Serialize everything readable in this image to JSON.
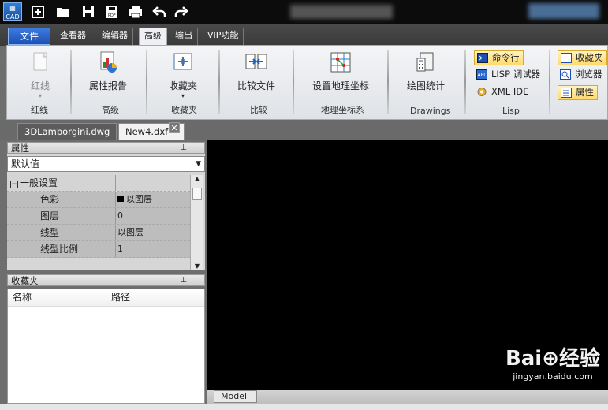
{
  "titlebar": {
    "logo_text": "CAD",
    "quick_actions": [
      "new-icon",
      "open-icon",
      "save-icon",
      "save-pdf-icon",
      "print-icon",
      "undo-icon",
      "redo-icon"
    ]
  },
  "tabs": {
    "file": "文件",
    "items": [
      "查看器",
      "编辑器",
      "高级",
      "输出",
      "VIP功能"
    ],
    "active": "高级"
  },
  "ribbon": {
    "groups": [
      {
        "label": "红线",
        "button": "红线"
      },
      {
        "label": "高级",
        "button": "属性报告"
      },
      {
        "label": "收藏夹",
        "button": "收藏夹"
      },
      {
        "label": "比较",
        "button": "比较文件"
      },
      {
        "label": "地理坐标系",
        "button": "设置地理坐标"
      },
      {
        "label": "Drawings",
        "button": "绘图统计"
      },
      {
        "label": "Lisp",
        "small_buttons": [
          "命令行",
          "LISP 调试器",
          "XML IDE"
        ]
      },
      {
        "label": "",
        "small_buttons": [
          "收藏夹",
          "浏览器",
          "属性"
        ]
      }
    ]
  },
  "doc_tabs": [
    "3DLamborgini.dwg",
    "New4.dxf"
  ],
  "doc_close_glyph": "✕",
  "properties_panel": {
    "title": "属性",
    "dropdown_value": "默认值",
    "category": "一般设置",
    "rows": [
      {
        "key": "色彩",
        "value": "以图层"
      },
      {
        "key": "图层",
        "value": "0"
      },
      {
        "key": "线型",
        "value": "以图层"
      },
      {
        "key": "线型比例",
        "value": "1"
      }
    ]
  },
  "favorites_panel": {
    "title": "收藏夹",
    "columns": [
      "名称",
      "路径"
    ]
  },
  "model_tab": "Model",
  "watermark": {
    "line1": "Bai⊕经验",
    "line2": "jingyan.baidu.com"
  },
  "colors": {
    "accent": "#1d4fb3",
    "highlight": "#ffd96a",
    "canvas": "#000000"
  }
}
